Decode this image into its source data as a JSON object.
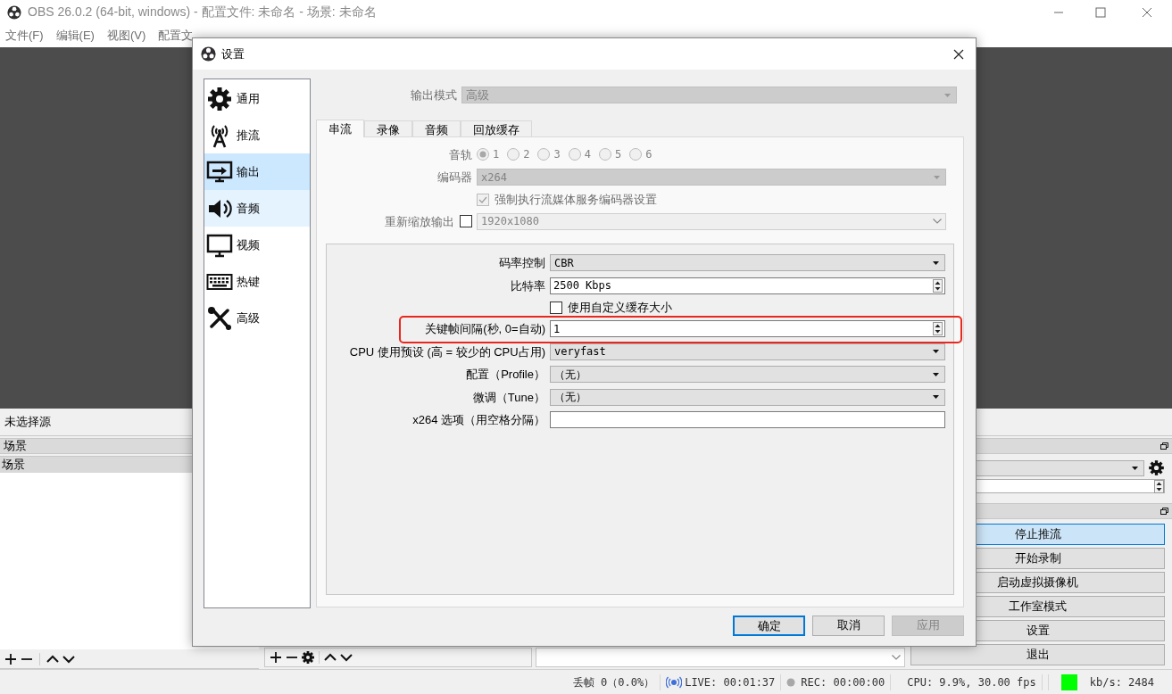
{
  "window": {
    "title": "OBS 26.0.2 (64-bit, windows) - 配置文件: 未命名 - 场景: 未命名"
  },
  "menu": [
    "文件(F)",
    "编辑(E)",
    "视图(V)",
    "配置文"
  ],
  "source_bar": {
    "text": "未选择源"
  },
  "scenes_dock": {
    "title": "场景",
    "items": [
      {
        "label": "场景",
        "selected": true
      }
    ]
  },
  "controls_dock": {
    "buttons": [
      {
        "label": "停止推流",
        "active": true
      },
      {
        "label": "开始录制",
        "active": false
      },
      {
        "label": "启动虚拟摄像机",
        "active": false
      },
      {
        "label": "工作室模式",
        "active": false
      },
      {
        "label": "设置",
        "active": false
      },
      {
        "label": "退出",
        "active": false
      }
    ]
  },
  "status_bar": {
    "dropped": "丢帧 0（0.0%）",
    "live": "LIVE: 00:01:37",
    "rec": "REC: 00:00:00",
    "cpu": "CPU: 9.9%, 30.00 fps",
    "kbps": "kb/s: 2484"
  },
  "settings": {
    "title": "设置",
    "nav": [
      {
        "label": "通用",
        "selected": false,
        "hovered": false
      },
      {
        "label": "推流",
        "selected": false,
        "hovered": false
      },
      {
        "label": "输出",
        "selected": true,
        "hovered": false
      },
      {
        "label": "音频",
        "selected": false,
        "hovered": true
      },
      {
        "label": "视频",
        "selected": false,
        "hovered": false
      },
      {
        "label": "热键",
        "selected": false,
        "hovered": false
      },
      {
        "label": "高级",
        "selected": false,
        "hovered": false
      }
    ],
    "output_mode": {
      "label": "输出模式",
      "value": "高级",
      "disabled": true
    },
    "tabs": [
      {
        "label": "串流",
        "selected": true
      },
      {
        "label": "录像",
        "selected": false
      },
      {
        "label": "音频",
        "selected": false
      },
      {
        "label": "回放缓存",
        "selected": false
      }
    ],
    "audio_track": {
      "label": "音轨",
      "disabled": true,
      "options": [
        {
          "label": "1",
          "selected": true
        },
        {
          "label": "2",
          "selected": false
        },
        {
          "label": "3",
          "selected": false
        },
        {
          "label": "4",
          "selected": false
        },
        {
          "label": "5",
          "selected": false
        },
        {
          "label": "6",
          "selected": false
        }
      ]
    },
    "encoder": {
      "label": "编码器",
      "value": "x264",
      "disabled": true
    },
    "enforce": {
      "label": "强制执行流媒体服务编码器设置",
      "checked": true,
      "disabled": true
    },
    "rescale": {
      "label": "重新缩放输出",
      "checked": false,
      "value": "1920x1080",
      "disabled": true
    },
    "encoder_settings": [
      {
        "kind": "dropdown",
        "label": "码率控制",
        "value": "CBR",
        "highlighted": false
      },
      {
        "kind": "spinbox",
        "label": "比特率",
        "value": "2500 Kbps",
        "highlighted": false
      },
      {
        "kind": "checkbox",
        "label": "使用自定义缓存大小",
        "checked": false,
        "highlighted": false
      },
      {
        "kind": "spinbox",
        "label": "关键帧间隔(秒, 0=自动)",
        "value": "1",
        "highlighted": true
      },
      {
        "kind": "dropdown",
        "label": "CPU 使用预设 (高 = 较少的 CPU占用)",
        "value": "veryfast",
        "highlighted": false
      },
      {
        "kind": "dropdown",
        "label": "配置（Profile）",
        "value": "（无）",
        "highlighted": false
      },
      {
        "kind": "dropdown",
        "label": "微调（Tune）",
        "value": "（无）",
        "highlighted": false
      },
      {
        "kind": "text",
        "label": "x264 选项（用空格分隔）",
        "highlighted": false
      }
    ],
    "buttons": [
      {
        "label": "确定",
        "kind": "default"
      },
      {
        "label": "取消",
        "kind": "normal"
      },
      {
        "label": "应用",
        "kind": "disabled"
      }
    ]
  }
}
